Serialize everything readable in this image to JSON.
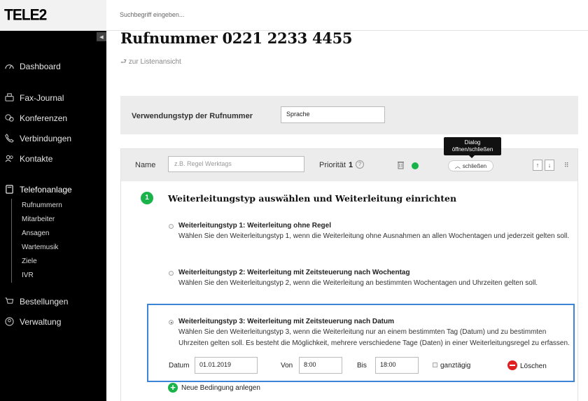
{
  "brand": {
    "logo": "TELE2",
    "accent": "#19b34a",
    "highlight": "#3b84d8",
    "danger": "#e02020"
  },
  "sidebar": {
    "items": [
      {
        "label": "Dashboard",
        "icon": "dashboard-icon"
      },
      {
        "label": "Fax-Journal",
        "icon": "fax-icon"
      },
      {
        "label": "Konferenzen",
        "icon": "conference-icon"
      },
      {
        "label": "Verbindungen",
        "icon": "phone-icon"
      },
      {
        "label": "Kontakte",
        "icon": "contacts-icon"
      },
      {
        "label": "Telefonanlage",
        "icon": "phone-system-icon"
      },
      {
        "label": "Bestellungen",
        "icon": "cart-icon"
      },
      {
        "label": "Verwaltung",
        "icon": "user-admin-icon"
      }
    ],
    "subitems": [
      "Rufnummern",
      "Mitarbeiter",
      "Ansagen",
      "Wartemusik",
      "Ziele",
      "IVR"
    ]
  },
  "search": {
    "placeholder": "Suchbegriff eingeben..."
  },
  "page": {
    "title": "Rufnummer  0221 2233 4455",
    "back": "zur Listenansicht"
  },
  "usage": {
    "label": "Verwendungstyp der Rufnummer",
    "value": "Sprache"
  },
  "tooltip": {
    "line1": "Dialog",
    "line2": "öffnen/schließen"
  },
  "rule": {
    "name_label": "Name",
    "name_placeholder": "z.B. Regel Werktags",
    "priority_label": "Priorität",
    "priority_value": "1",
    "help": "?",
    "close_label": "schließen",
    "up": "↑",
    "down": "↓",
    "drag": "⠿"
  },
  "step": {
    "number": "1",
    "title": "Weiterleitungstyp auswählen und Weiterleitung einrichten"
  },
  "options": [
    {
      "title": "Weiterleitungstyp 1: Weiterleitung ohne Regel",
      "desc": "Wählen Sie den Weiterleitungstyp 1, wenn die Weiterleitung ohne Ausnahmen an allen Wochentagen und jederzeit gelten soll."
    },
    {
      "title": "Weiterleitungstyp 2: Weiterleitung mit Zeitsteuerung nach Wochentag",
      "desc": "Wählen Sie den Weiterleitungstyp 2, wenn die Weiterleitung an bestimmten Wochentagen und Uhrzeiten gelten soll."
    },
    {
      "title": "Weiterleitungstyp 3: Weiterleitung mit Zeitsteuerung nach Datum",
      "desc": "Wählen Sie den Weiterleitungstyp 3, wenn die Weiterleitung nur an einem bestimmten Tag (Datum) und zu bestimmten Uhrzeiten gelten soll. Es besteht die Möglichkeit, mehrere verschiedene Tage (Daten) in einer Weiterleitungsregel zu erfassen."
    }
  ],
  "date_row": {
    "date_label": "Datum",
    "date_value": "01.01.2019",
    "from_label": "Von",
    "from_value": "8:00",
    "to_label": "Bis",
    "to_value": "18:00",
    "allday_label": "ganztägig",
    "delete_label": "Löschen"
  },
  "new_condition": "Neue Bedingung anlegen"
}
